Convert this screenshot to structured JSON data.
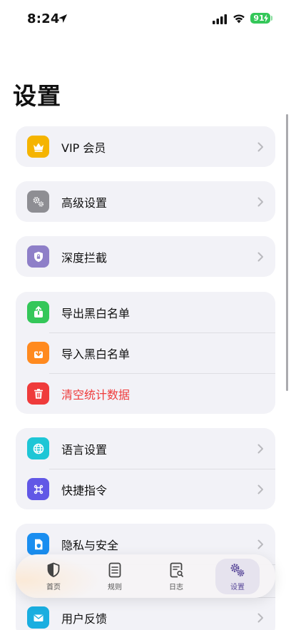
{
  "status_bar": {
    "time": "8:24",
    "battery": "91"
  },
  "page": {
    "title": "设置"
  },
  "groups": {
    "vip": {
      "label": "VIP 会员",
      "color": "#f5b400"
    },
    "advanced": {
      "label": "高级设置",
      "color": "#8e8e93"
    },
    "deep_block": {
      "label": "深度拦截",
      "color": "#8e7fc8"
    },
    "data": {
      "export": {
        "label": "导出黑白名单",
        "color": "#34c759"
      },
      "import": {
        "label": "导入黑白名单",
        "color": "#ff8a1f"
      },
      "clear": {
        "label": "清空统计数据",
        "color": "#ef3b3b"
      }
    },
    "prefs": {
      "language": {
        "label": "语言设置",
        "color": "#1ec6d6"
      },
      "shortcuts": {
        "label": "快捷指令",
        "color": "#6157e6"
      }
    },
    "support": {
      "privacy": {
        "label": "隐私与安全",
        "color": "#1a8ef0"
      },
      "feedback": {
        "label": "用户反馈",
        "color": "#1aaee0"
      }
    }
  },
  "tab_bar": {
    "home": "首页",
    "rules": "规则",
    "logs": "日志",
    "settings": "设置"
  }
}
